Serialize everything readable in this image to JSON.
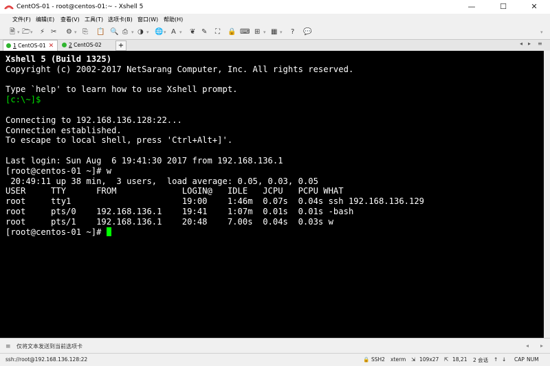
{
  "window": {
    "title": "CentOS-01 - root@centos-01:~ - Xshell 5"
  },
  "menu": [
    "文件(F)",
    "编辑(E)",
    "查看(V)",
    "工具(T)",
    "选项卡(B)",
    "窗口(W)",
    "帮助(H)"
  ],
  "tabs": [
    {
      "number": "1",
      "label": "CentOS-01"
    },
    {
      "number": "2",
      "label": "CentOS-02"
    }
  ],
  "tab_add": "+",
  "terminal": {
    "banner_title": "Xshell 5 (Build 1325)",
    "banner_copyright": "Copyright (c) 2002-2017 NetSarang Computer, Inc. All rights reserved.",
    "help_line": "Type `help' to learn how to use Xshell prompt.",
    "local_prompt": "[c:\\~]$",
    "connecting": "Connecting to 192.168.136.128:22...",
    "established": "Connection established.",
    "escape": "To escape to local shell, press 'Ctrl+Alt+]'.",
    "last_login": "Last login: Sun Aug  6 19:41:30 2017 from 192.168.136.1",
    "cmd_line": "[root@centos-01 ~]# w",
    "uptime": " 20:49:11 up 38 min,  3 users,  load average: 0.05, 0.03, 0.05",
    "w_header": "USER     TTY      FROM             LOGIN@   IDLE   JCPU   PCPU WHAT",
    "w_rows": [
      "root     tty1                      19:00    1:46m  0.07s  0.04s ssh 192.168.136.129",
      "root     pts/0    192.168.136.1    19:41    1:07m  0.01s  0.01s -bash",
      "root     pts/1    192.168.136.1    20:48    7.00s  0.04s  0.03s w"
    ],
    "final_prompt": "[root@centos-01 ~]# "
  },
  "compose": {
    "placeholder": "仅将文本发送到当前选项卡"
  },
  "status": {
    "connection": "ssh://root@192.168.136.128:22",
    "protocol": "SSH2",
    "terminal_type": "xterm",
    "size": "109x27",
    "cursor_pos": "18,21",
    "sessions": "2 会话",
    "caps": "CAP",
    "num": "NUM"
  },
  "colors": {
    "terminal_bg": "#000000",
    "terminal_fg": "#ffffff",
    "prompt": "#00e000",
    "cursor": "#00ff00"
  }
}
